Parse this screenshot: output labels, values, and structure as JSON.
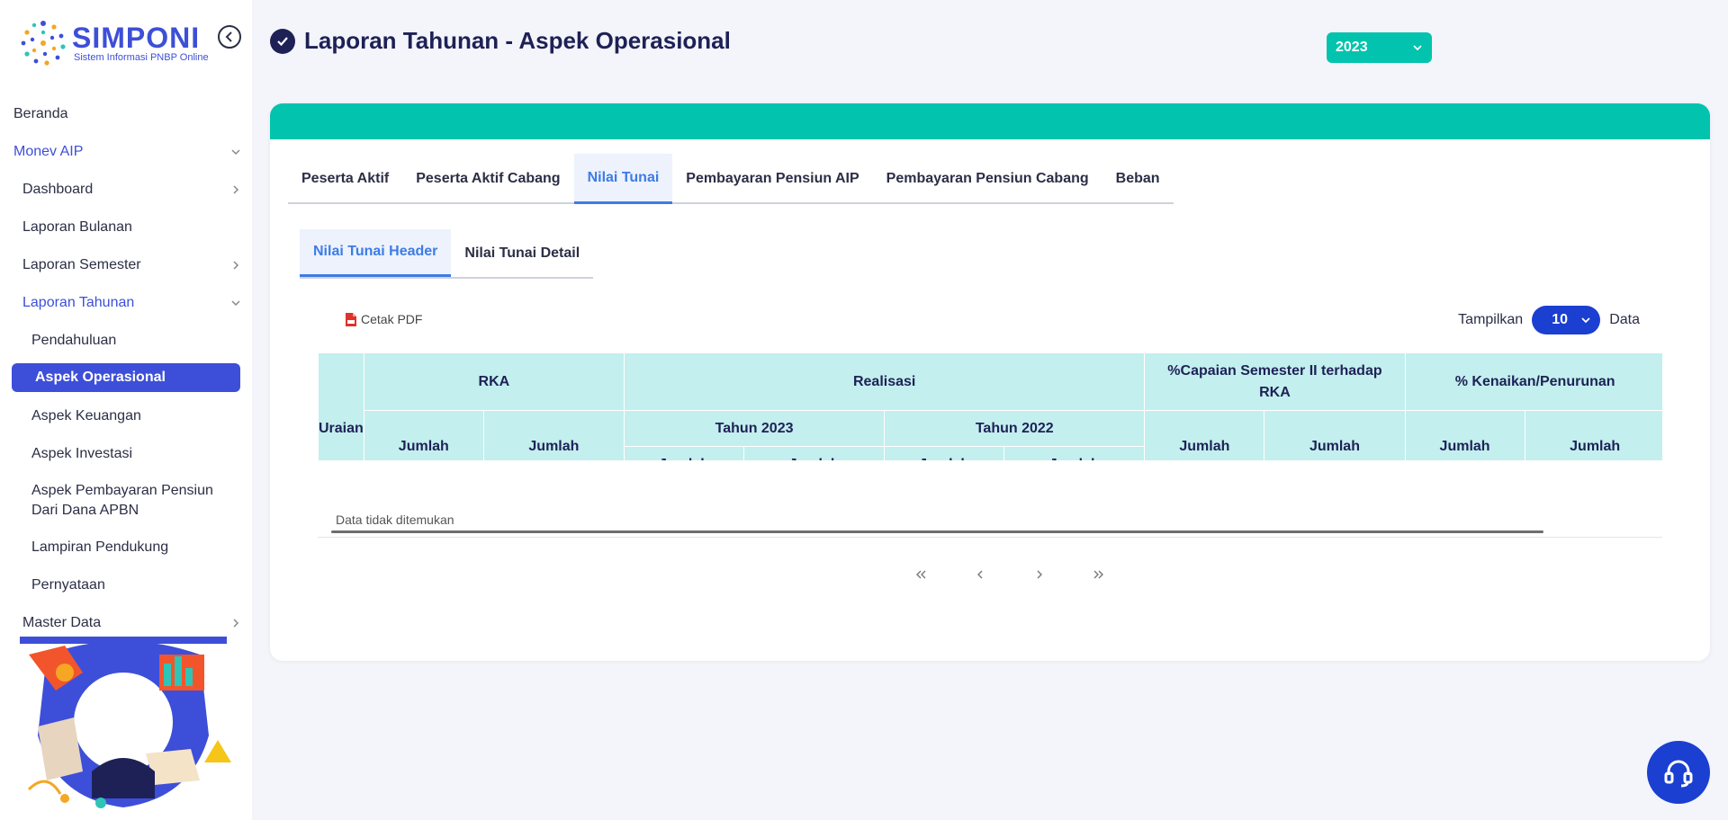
{
  "app": {
    "logo_title": "SIMPONI",
    "logo_subtitle": "Sistem Informasi PNBP Online"
  },
  "sidebar": {
    "items": [
      {
        "label": "Beranda"
      },
      {
        "label": "Monev AIP"
      },
      {
        "label": "Dashboard"
      },
      {
        "label": "Laporan Bulanan"
      },
      {
        "label": "Laporan Semester"
      },
      {
        "label": "Laporan Tahunan"
      },
      {
        "label": "Pendahuluan"
      },
      {
        "label": "Aspek Operasional"
      },
      {
        "label": "Aspek Keuangan"
      },
      {
        "label": "Aspek Investasi"
      },
      {
        "label": "Aspek Pembayaran Pensiun Dari Dana APBN"
      },
      {
        "label": "Lampiran Pendukung"
      },
      {
        "label": "Pernyataan"
      },
      {
        "label": "Master Data"
      }
    ]
  },
  "header": {
    "title": "Laporan Tahunan - Aspek Operasional",
    "year_selected": "2023"
  },
  "tabs": [
    {
      "label": "Peserta Aktif"
    },
    {
      "label": "Peserta Aktif Cabang"
    },
    {
      "label": "Nilai Tunai"
    },
    {
      "label": "Pembayaran Pensiun AIP"
    },
    {
      "label": "Pembayaran Pensiun Cabang"
    },
    {
      "label": "Beban"
    }
  ],
  "subtabs": [
    {
      "label": "Nilai Tunai Header"
    },
    {
      "label": "Nilai Tunai Detail"
    }
  ],
  "toolbar": {
    "pdf_label": "Cetak PDF",
    "show_prefix": "Tampilkan",
    "show_value": "10",
    "show_suffix": "Data"
  },
  "table": {
    "uraian": "Uraian",
    "rka": "RKA",
    "realisasi": "Realisasi",
    "capaian": "%Capaian Semester II terhadap RKA",
    "kenaikan": "% Kenaikan/Penurunan",
    "tahun_2023": "Tahun 2023",
    "tahun_2022": "Tahun 2022",
    "jumlah_penerima": "Jumlah Penerima",
    "jumlah_pembayaran": "Jumlah Pembayaran",
    "empty_message": "Data tidak ditemukan"
  },
  "pager": {
    "first": "«",
    "prev": "‹",
    "next": "›",
    "last": "»"
  },
  "colors": {
    "primary": "#3d4fd8",
    "teal": "#02c3ae",
    "header_cell": "#c3efee"
  }
}
